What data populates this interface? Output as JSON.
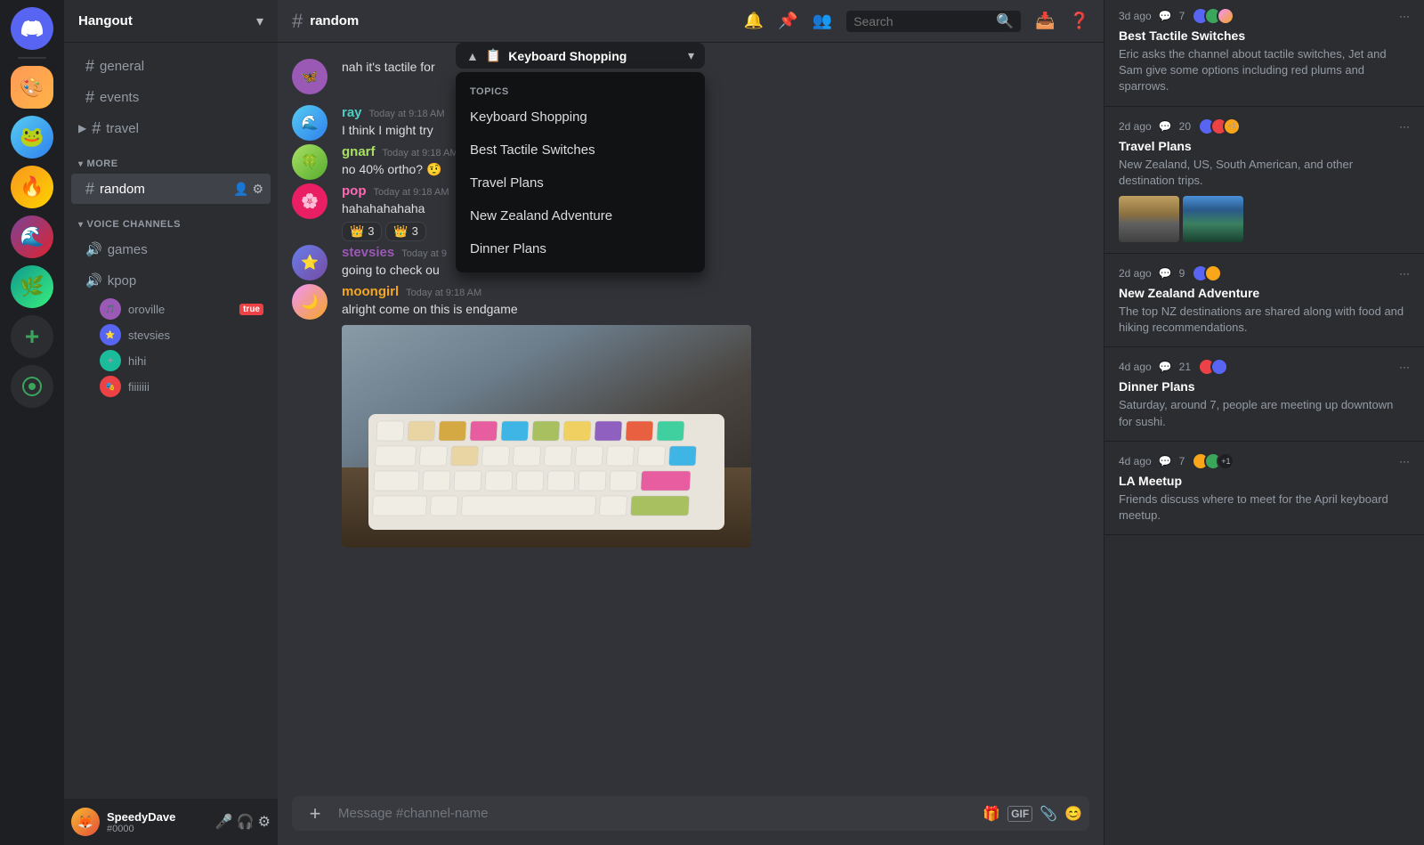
{
  "app": {
    "title": "Discord"
  },
  "server": {
    "name": "Hangout",
    "channels": {
      "text": [
        {
          "id": "general",
          "name": "general"
        },
        {
          "id": "events",
          "name": "events"
        },
        {
          "id": "travel",
          "name": "travel"
        }
      ],
      "more_label": "MORE",
      "active": "random",
      "active_name": "random"
    },
    "voice": {
      "section_label": "VOICE CHANNELS",
      "channels": [
        {
          "id": "games",
          "name": "games"
        },
        {
          "id": "kpop",
          "name": "kpop"
        }
      ],
      "users": [
        {
          "name": "oroville",
          "live": true
        },
        {
          "name": "stevsies",
          "live": false
        },
        {
          "name": "hihi",
          "live": false
        },
        {
          "name": "fiiiiiii",
          "live": false
        }
      ]
    }
  },
  "chat": {
    "channel_name": "random",
    "messages": [
      {
        "id": "msg1",
        "username": "",
        "time": "",
        "text": "nah it's tactile for",
        "avatar_color": "av-purple"
      },
      {
        "id": "msg2",
        "username": "ray",
        "time": "Today at 9:18 AM",
        "text": "I think I might try",
        "avatar_color": "av-teal"
      },
      {
        "id": "msg3",
        "username": "gnarf",
        "time": "Today at 9:18 AM",
        "text": "no 40% ortho? 🤨",
        "avatar_color": "av-green"
      },
      {
        "id": "msg4",
        "username": "pop",
        "time": "Today at 9:18 AM",
        "text": "hahahahahaha",
        "avatar_color": "av-pink",
        "reactions": [
          {
            "emoji": "👑",
            "count": 3
          },
          {
            "emoji": "👑",
            "count": 3
          }
        ]
      },
      {
        "id": "msg5",
        "username": "stevsies",
        "time": "Today at 9",
        "text": "going to check ou",
        "avatar_color": "av-blue"
      },
      {
        "id": "msg6",
        "username": "moongirl",
        "time": "Today at 9:18 AM",
        "text": "alright come on this is endgame",
        "avatar_color": "av-orange",
        "has_image": true
      }
    ],
    "input_placeholder": "Message #channel-name"
  },
  "topics_dropdown": {
    "trigger_label": "Keyboard Shopping",
    "section_label": "TOPICS",
    "items": [
      {
        "id": "keyboard-shopping",
        "label": "Keyboard Shopping"
      },
      {
        "id": "best-tactile",
        "label": "Best Tactile Switches"
      },
      {
        "id": "travel-plans",
        "label": "Travel Plans"
      },
      {
        "id": "nz-adventure",
        "label": "New Zealand Adventure"
      },
      {
        "id": "dinner-plans",
        "label": "Dinner Plans"
      }
    ]
  },
  "right_panel": {
    "threads": [
      {
        "id": "best-tactile",
        "age": "3d ago",
        "comments": 7,
        "title": "Best Tactile Switches",
        "description": "Eric asks the channel about tactile switches, Jet and Sam give some options including red plums and sparrows."
      },
      {
        "id": "travel-plans",
        "age": "2d ago",
        "comments": 20,
        "title": "Travel Plans",
        "description": "New Zealand, US, South American, and other destination trips.",
        "has_images": true
      },
      {
        "id": "nz-adventure",
        "age": "2d ago",
        "comments": 9,
        "title": "New Zealand Adventure",
        "description": "The top NZ destinations are shared along with food and hiking recommendations."
      },
      {
        "id": "dinner-plans",
        "age": "4d ago",
        "comments": 21,
        "title": "Dinner Plans",
        "description": "Saturday, around 7, people are meeting up downtown for sushi."
      },
      {
        "id": "la-meetup",
        "age": "4d ago",
        "comments": 7,
        "title": "LA Meetup",
        "description": "Friends discuss where to meet for the April keyboard meetup."
      }
    ]
  },
  "user": {
    "name": "SpeedyDave",
    "tag": "#0000"
  },
  "icons": {
    "hash": "#",
    "chevron_down": "▾",
    "chevron_up": "▴",
    "bell": "🔔",
    "pin": "📌",
    "members": "👥",
    "inbox": "📥",
    "help": "❓",
    "search": "🔍",
    "mic": "🎤",
    "headset": "🎧",
    "settings": "⚙",
    "add": "+",
    "gift": "🎁",
    "gif": "GIF",
    "attachment": "📎",
    "emoji": "😊",
    "speaker": "🔊",
    "add_member": "👤+",
    "cog": "⚙"
  }
}
